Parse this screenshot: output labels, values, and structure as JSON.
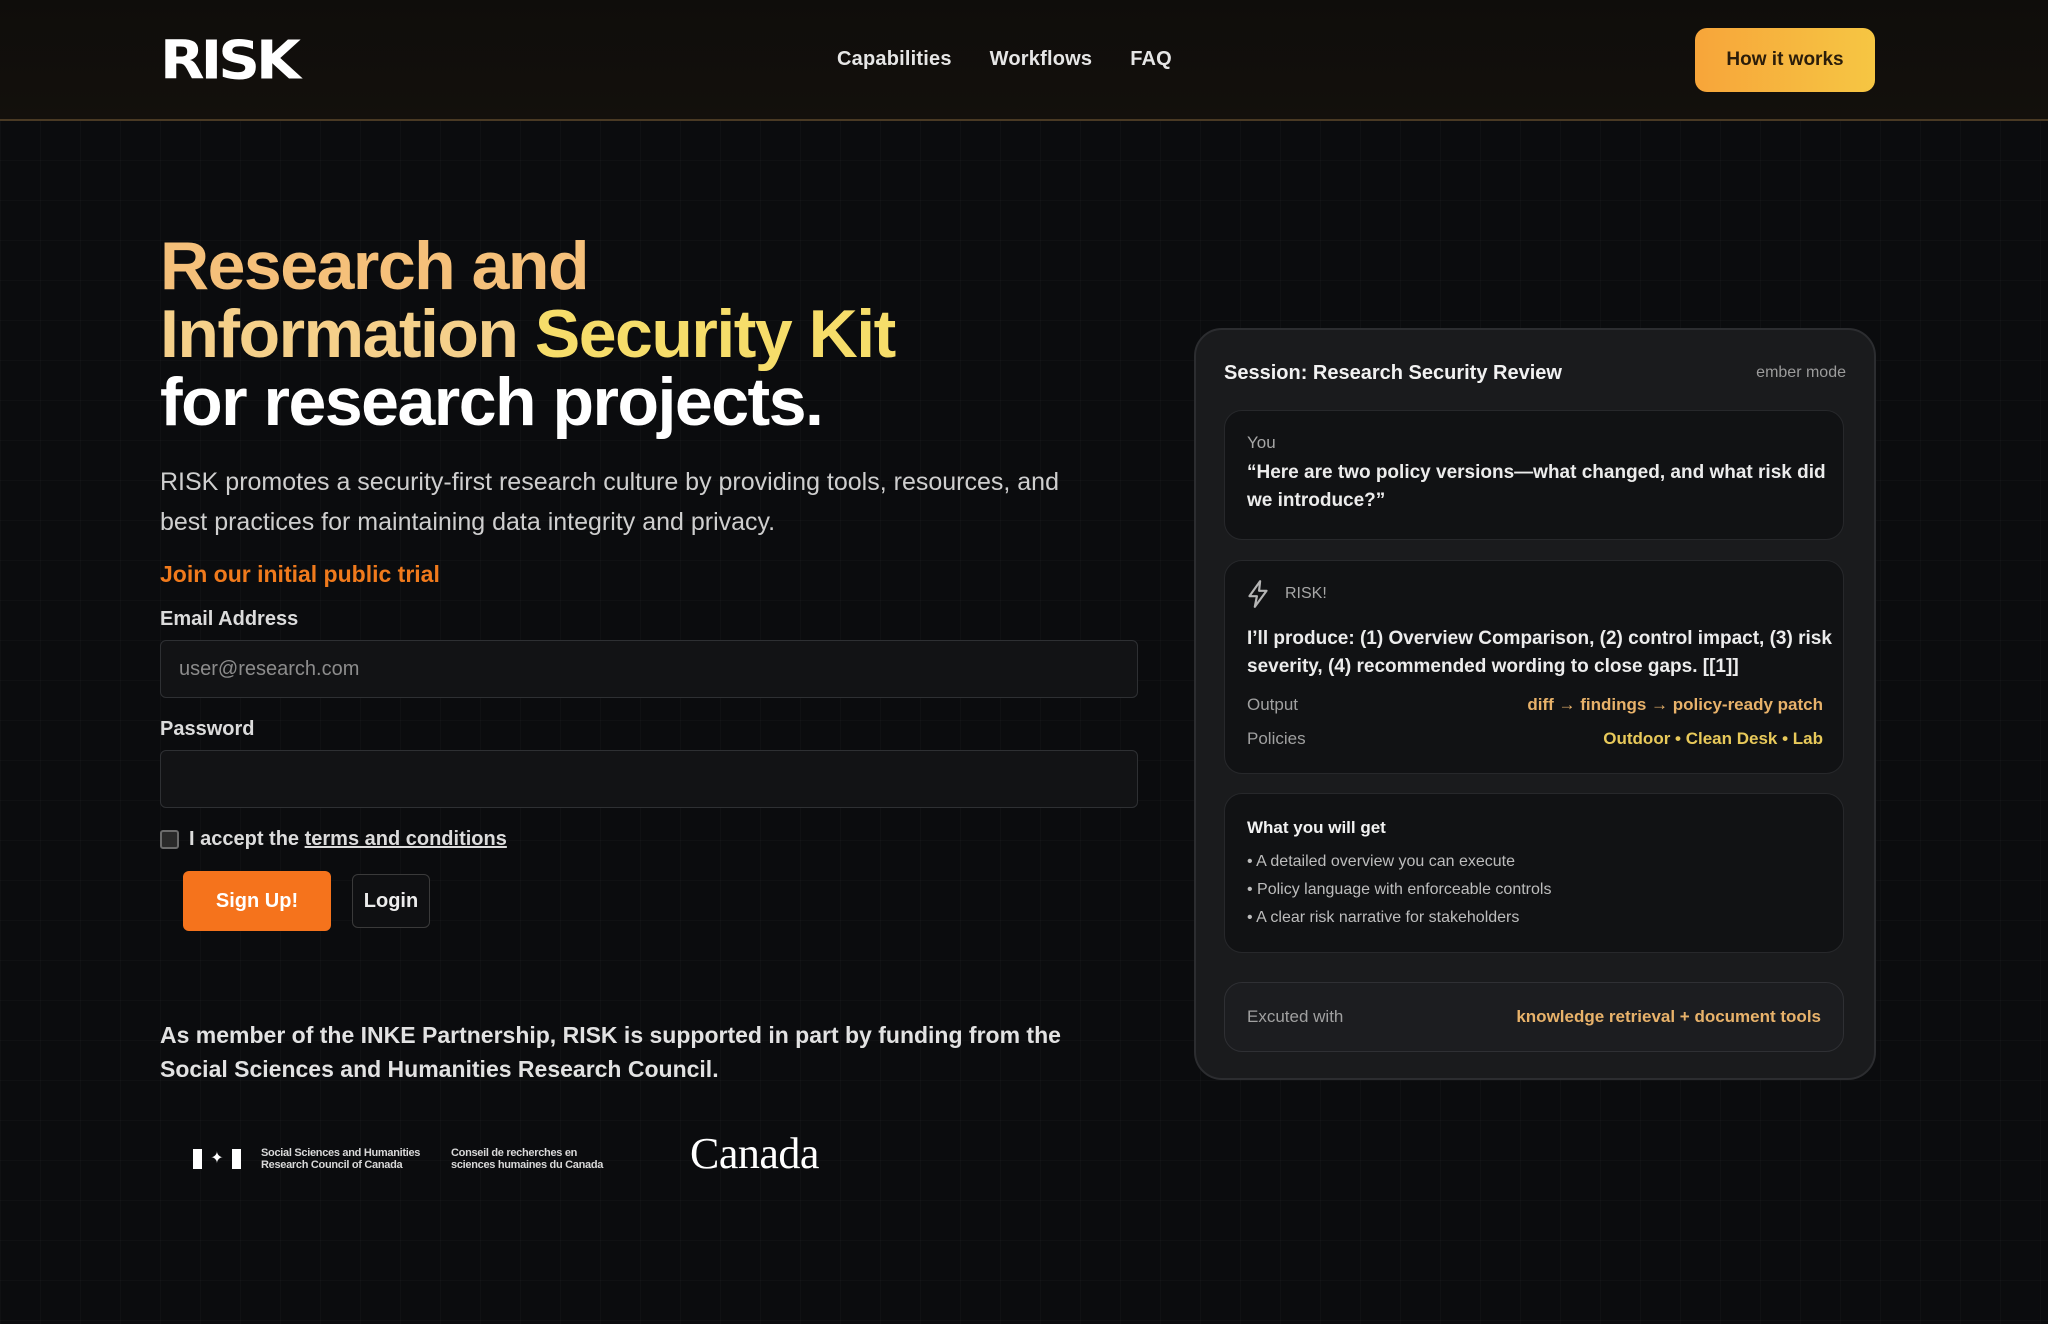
{
  "header": {
    "logo": "RISK",
    "nav": [
      "Capabilities",
      "Workflows",
      "FAQ"
    ],
    "cta": "How it works"
  },
  "hero": {
    "title_line1": "Research and",
    "title_line2a": "Information ",
    "title_line2b": "Security Kit",
    "title_line3": "for research projects.",
    "description": "RISK promotes a security-first research culture by providing tools, resources, and best practices for maintaining data integrity and privacy.",
    "trial_heading": "Join our initial public trial"
  },
  "form": {
    "email_label": "Email Address",
    "email_placeholder": "user@research.com",
    "email_value": "",
    "password_label": "Password",
    "password_value": "",
    "terms_prefix": "I accept the ",
    "terms_link": "terms and conditions",
    "terms_checked": false,
    "signup_label": "Sign Up!",
    "login_label": "Login"
  },
  "footer": {
    "member_text": "As member of the INKE Partnership, RISK is supported in part by funding from the Social Sciences and Humanities Research Council.",
    "sshrc_en": "Social Sciences and Humanities Research Council of Canada",
    "sshrc_fr": "Conseil de recherches en sciences humaines du Canada",
    "canada_wordmark": "Canada"
  },
  "panel": {
    "title": "Session: Research Security Review",
    "mode": "ember mode",
    "you_label": "You",
    "you_text": "“Here are two policy versions—what changed, and what risk did we introduce?”",
    "risk_label": "RISK!",
    "risk_text": "I’ll produce: (1) Overview Comparison, (2) control impact, (3) risk severity, (4) recommended wording to close gaps. [[1]]",
    "output_key": "Output",
    "output_val": "diff → findings → policy-ready patch",
    "policies_key": "Policies",
    "policies_val": "Outdoor • Clean Desk • Lab",
    "get_title": "What you will get",
    "get_items": [
      "• A detailed overview you can execute",
      "• Policy language with enforceable controls",
      "• A clear risk narrative for stakeholders"
    ],
    "exec_key": "Excuted with",
    "exec_val": "knowledge retrieval + document tools"
  },
  "colors": {
    "accent_orange": "#f5731c",
    "cta_gradient_start": "#f7a53a",
    "cta_gradient_end": "#f6c643",
    "background": "#0b0c0e"
  }
}
